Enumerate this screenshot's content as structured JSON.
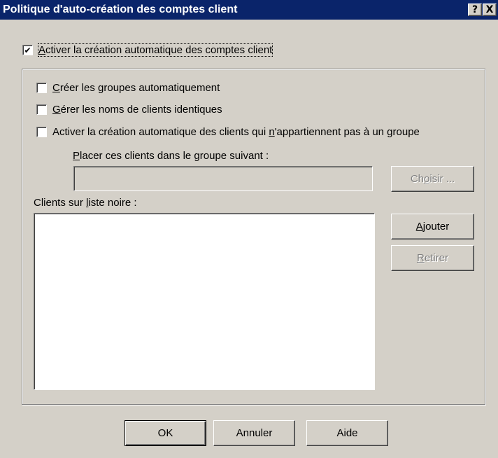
{
  "window": {
    "title": "Politique d'auto-création des comptes client",
    "help_glyph": "?",
    "close_glyph": "X"
  },
  "enable_auto": {
    "checked": true,
    "check_glyph": "✔",
    "label_u": "A",
    "label_rest": "ctiver la création automatique des comptes client"
  },
  "options": {
    "create_groups": {
      "checked": false,
      "label_u": "C",
      "label_rest": "réer les groupes automatiquement"
    },
    "manage_names": {
      "checked": false,
      "label_u": "G",
      "label_rest": "érer les noms de clients identiques"
    },
    "no_group": {
      "checked": false,
      "label_before": "Activer la création automatique des clients qui ",
      "label_u": "n",
      "label_after": "'appartiennent pas à un groupe"
    }
  },
  "target_group": {
    "label_u": "P",
    "label_rest": "lacer ces clients dans le groupe suivant :",
    "value": "",
    "choose_before": "Ch",
    "choose_u": "o",
    "choose_after": "isir ..."
  },
  "blacklist": {
    "label_before": "Clients sur ",
    "label_u": "l",
    "label_after": "iste noire :",
    "items": [],
    "add_u": "A",
    "add_rest": "jouter",
    "remove_u": "R",
    "remove_rest": "etirer"
  },
  "footer": {
    "ok": "OK",
    "cancel": "Annuler",
    "help": "Aide"
  }
}
